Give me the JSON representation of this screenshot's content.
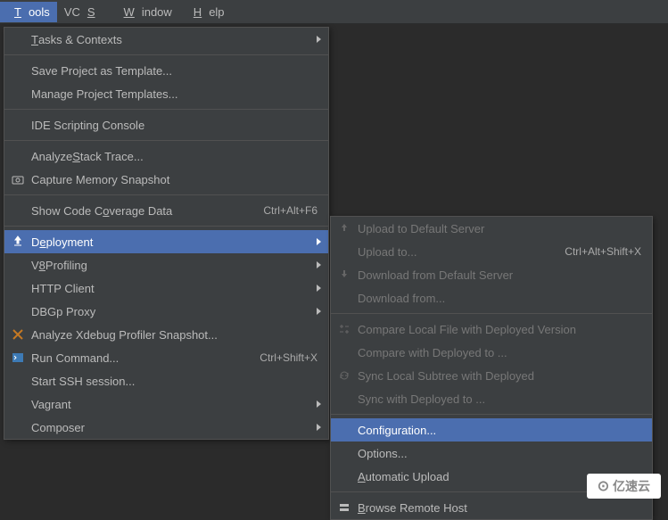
{
  "menubar": {
    "tools": "Tools",
    "vcs": "VCS",
    "window": "Window",
    "help": "Help"
  },
  "tools": {
    "tasks": "Tasks & Contexts",
    "saveProject": "Save Project as Template...",
    "manageTemplates": "Manage Project Templates...",
    "ideScripting": "IDE Scripting Console",
    "analyzeStack": "Analyze Stack Trace...",
    "captureMemory": "Capture Memory Snapshot",
    "showCoverage": "Show Code Coverage Data",
    "showCoverageKey": "Ctrl+Alt+F6",
    "deployment": "Deployment",
    "v8": "V8 Profiling",
    "httpClient": "HTTP Client",
    "dbgp": "DBGp Proxy",
    "xdebug": "Analyze Xdebug Profiler Snapshot...",
    "runCmd": "Run Command...",
    "runCmdKey": "Ctrl+Shift+X",
    "ssh": "Start SSH session...",
    "vagrant": "Vagrant",
    "composer": "Composer"
  },
  "deploy": {
    "uploadDefault": "Upload to Default Server",
    "uploadTo": "Upload to...",
    "uploadToKey": "Ctrl+Alt+Shift+X",
    "downloadDefault": "Download from Default Server",
    "downloadFrom": "Download from...",
    "compareLocal": "Compare Local File with Deployed Version",
    "compareWith": "Compare with Deployed to ...",
    "syncLocal": "Sync Local Subtree with Deployed",
    "syncWith": "Sync with Deployed to ...",
    "configuration": "Configuration...",
    "options": "Options...",
    "autoUpload": "Automatic Upload",
    "browseRemote": "Browse Remote Host"
  },
  "logo": "亿速云"
}
